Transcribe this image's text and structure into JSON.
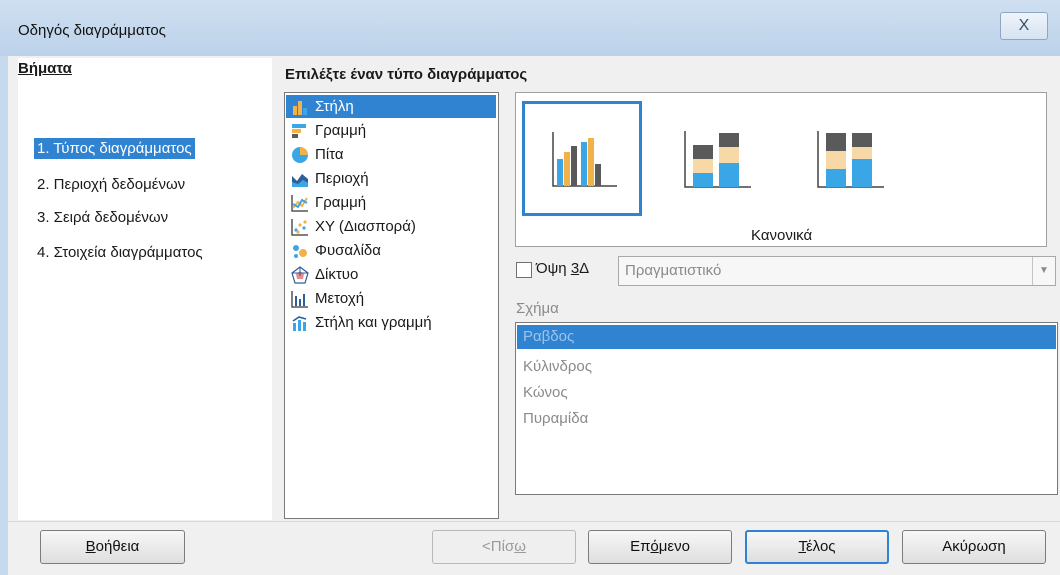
{
  "window": {
    "title": "Οδηγός διαγράμματος",
    "close_label": "X"
  },
  "steps": {
    "heading": "Βήματα",
    "items": [
      {
        "label": "1. Τύπος διαγράμματος",
        "active": true
      },
      {
        "label": "2. Περιοχή δεδομένων"
      },
      {
        "label": "3. Σειρά δεδομένων"
      },
      {
        "label": "4. Στοιχεία διαγράμματος"
      }
    ]
  },
  "chart_types": {
    "heading": "Επιλέξτε έναν τύπο διαγράμματος",
    "items": [
      {
        "label": "Στήλη",
        "icon": "column-chart-icon",
        "selected": true
      },
      {
        "label": "Γραμμή",
        "icon": "bar-chart-icon"
      },
      {
        "label": "Πίτα",
        "icon": "pie-chart-icon"
      },
      {
        "label": "Περιοχή",
        "icon": "area-chart-icon"
      },
      {
        "label": "Γραμμή",
        "icon": "line-chart-icon"
      },
      {
        "label": "XY (Διασπορά)",
        "icon": "scatter-chart-icon"
      },
      {
        "label": "Φυσαλίδα",
        "icon": "bubble-chart-icon"
      },
      {
        "label": "Δίκτυο",
        "icon": "net-chart-icon"
      },
      {
        "label": "Μετοχή",
        "icon": "stock-chart-icon"
      },
      {
        "label": "Στήλη και γραμμή",
        "icon": "column-line-chart-icon"
      }
    ]
  },
  "variants": {
    "selected_label": "Κανονικά"
  },
  "view3d": {
    "label_prefix": "Όψη ",
    "label_key": "3",
    "label_suffix": "Δ",
    "checked": false,
    "dropdown_value": "Πραγματιστικό"
  },
  "shape": {
    "label": "Σχήμα",
    "items": [
      {
        "label": "Ραβδος",
        "selected": true
      },
      {
        "label": "Κύλινδρος"
      },
      {
        "label": "Κώνος"
      },
      {
        "label": "Πυραμίδα"
      }
    ]
  },
  "buttons": {
    "help": {
      "prefix": "",
      "key": "Β",
      "suffix": "οήθεια"
    },
    "back": {
      "prefix": "<Πίσ",
      "key": "ω",
      "suffix": ""
    },
    "next": {
      "prefix": "Επ",
      "key": "ό",
      "suffix": "μενο"
    },
    "finish": {
      "prefix": "",
      "key": "Τ",
      "suffix": "έλος"
    },
    "cancel": {
      "label": "Ακύρωση"
    }
  },
  "colors": {
    "accent": "#2f83d1",
    "bar_blue": "#3aa6e6",
    "bar_orange": "#f1b24a",
    "bar_gray": "#5a5a5a",
    "bar_peach": "#f7d9a8"
  }
}
